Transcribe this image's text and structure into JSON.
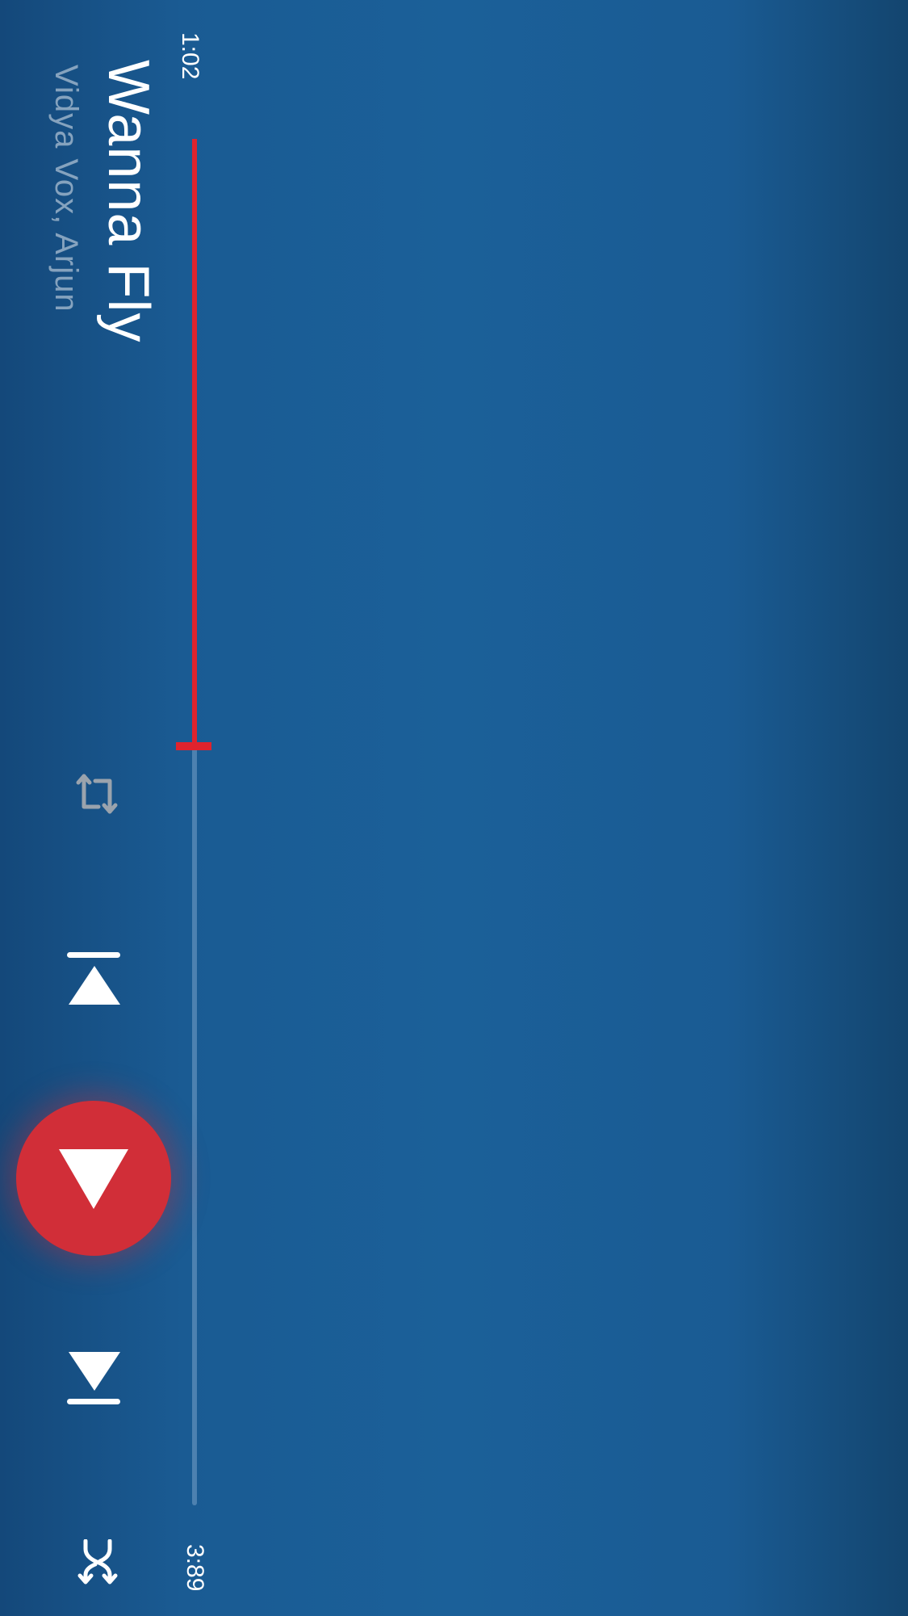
{
  "player": {
    "elapsed": "1:02",
    "duration": "3:89",
    "progress_fraction": 0.4447,
    "title": "Wanna Fly",
    "artist": "Vidya Vox, Arjun"
  },
  "icons": {
    "repeat": "repeat-icon",
    "previous": "skip-previous-icon",
    "play": "play-icon",
    "next": "skip-next-icon",
    "shuffle": "shuffle-icon"
  },
  "colors": {
    "accent": "#e0232d",
    "play_button": "#d12e38",
    "background": "#1b6099"
  }
}
